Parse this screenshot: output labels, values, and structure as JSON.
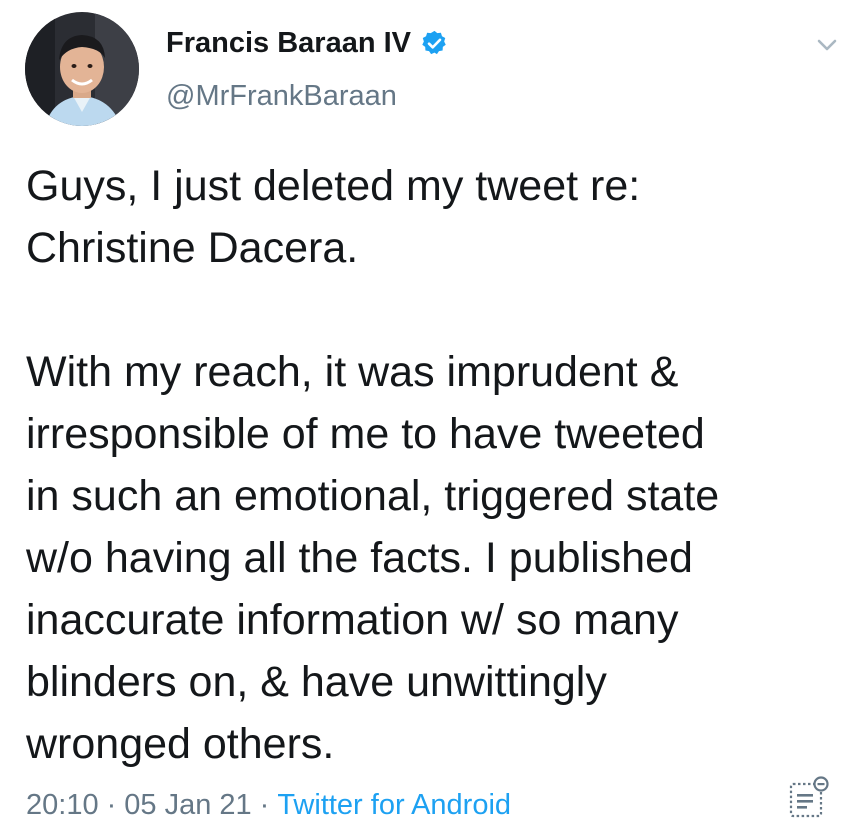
{
  "tweet": {
    "author": {
      "display_name": "Francis Baraan IV",
      "handle": "@MrFrankBaraan",
      "verified_icon": "verified-badge-icon",
      "avatar_icon": "avatar-photo"
    },
    "menu_icon": "chevron-down-icon",
    "text": "Guys, I just deleted my tweet re:\nChristine Dacera.\n\nWith my reach, it was imprudent &\nirresponsible of me to have tweeted\nin such an emotional, triggered state\nw/o having all the facts. I published\ninaccurate information w/ so many\nblinders on, & have unwittingly\nwronged others.",
    "time": "20:10",
    "separator": "·",
    "date": "05 Jan 21",
    "source": "Twitter for Android",
    "analytics_icon": "tweet-analytics-icon"
  },
  "colors": {
    "text": "#14171a",
    "secondary": "#657786",
    "link": "#1da1f2",
    "verified": "#1da1f2",
    "chevron": "#aab8c2"
  }
}
